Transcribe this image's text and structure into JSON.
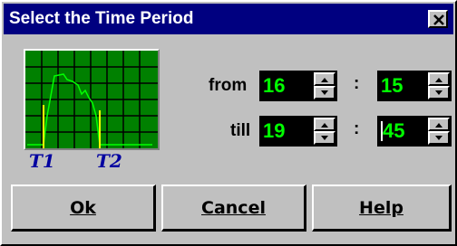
{
  "window": {
    "title": "Select the Time Period",
    "close_icon": "close-icon"
  },
  "chart": {
    "grid": true,
    "background": "#008000",
    "line_color": "#00ff00",
    "marker_color": "#ffff00",
    "marker_1": "T1",
    "marker_2": "T2"
  },
  "labels": {
    "from": "from",
    "till": "till",
    "separator": ":"
  },
  "from": {
    "hours": "16",
    "minutes": "15"
  },
  "till": {
    "hours": "19",
    "minutes": "45"
  },
  "colors": {
    "title_bar": "#000080",
    "field_bg": "#000000",
    "field_text": "#00ff00"
  },
  "buttons": {
    "ok": "Ok",
    "cancel": "Cancel",
    "help": "Help"
  }
}
